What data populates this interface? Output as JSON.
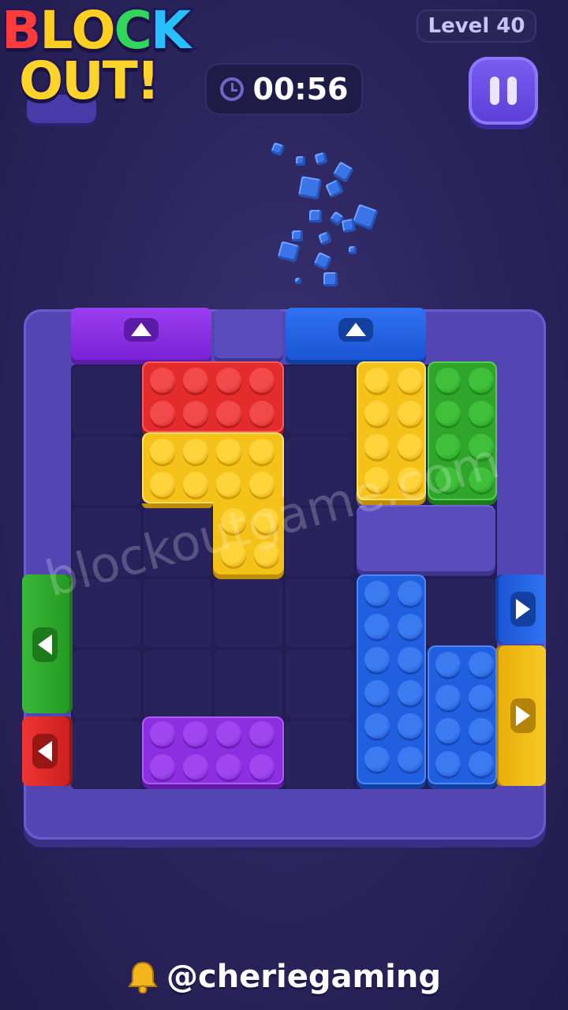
{
  "header": {
    "logo_line1_letters": [
      "B",
      "L",
      "O",
      "C",
      "K"
    ],
    "logo_line2_letters": [
      "O",
      "U",
      "T",
      "!"
    ],
    "level_label": "Level 40",
    "timer": "00:56",
    "clock_icon": "clock-icon",
    "pause_icon": "pause-icon"
  },
  "watermark": "blockoutgame.com",
  "footer": {
    "handle": "@cheriegaming",
    "icon": "bell-icon"
  },
  "colors": {
    "red": "#e52c2c",
    "yellow": "#f5c21a",
    "green": "#2fa62b",
    "blue": "#1f5fe0",
    "purple": "#8b2fe0",
    "board": "#5346b3"
  },
  "board": {
    "cols": 6,
    "rows": 6,
    "pieces": [
      {
        "name": "red-block",
        "color": "red",
        "cells": [
          [
            1,
            0
          ],
          [
            2,
            0
          ],
          [
            3,
            0
          ],
          [
            4,
            0
          ],
          [
            1,
            1
          ],
          [
            2,
            1
          ],
          [
            3,
            1
          ],
          [
            4,
            1
          ]
        ]
      },
      {
        "name": "yellow-l-block",
        "color": "yellow",
        "cells": "L"
      },
      {
        "name": "yellow-vertical-block",
        "color": "yellow",
        "col": 4,
        "row": 0,
        "w": 1,
        "h": 2
      },
      {
        "name": "green-vertical-block",
        "color": "green",
        "col": 5,
        "row": 0,
        "w": 1,
        "h": 2
      },
      {
        "name": "blue-tall-block",
        "color": "blue",
        "col": 4,
        "row": 3,
        "w": 1,
        "h": 3
      },
      {
        "name": "blue-short-block",
        "color": "blue",
        "col": 5,
        "row": 4,
        "w": 1,
        "h": 2
      },
      {
        "name": "purple-block",
        "color": "purple",
        "col": 1,
        "row": 5,
        "w": 2,
        "h": 1
      }
    ],
    "gates": [
      {
        "name": "top-purple-exit",
        "color": "purple",
        "direction": "up"
      },
      {
        "name": "top-blue-exit",
        "color": "blue",
        "direction": "up"
      },
      {
        "name": "left-green-exit",
        "color": "green",
        "direction": "left"
      },
      {
        "name": "left-red-exit",
        "color": "red",
        "direction": "left"
      },
      {
        "name": "right-blue-exit",
        "color": "blue",
        "direction": "right"
      },
      {
        "name": "right-yellow-exit",
        "color": "yellow",
        "direction": "right"
      }
    ]
  }
}
